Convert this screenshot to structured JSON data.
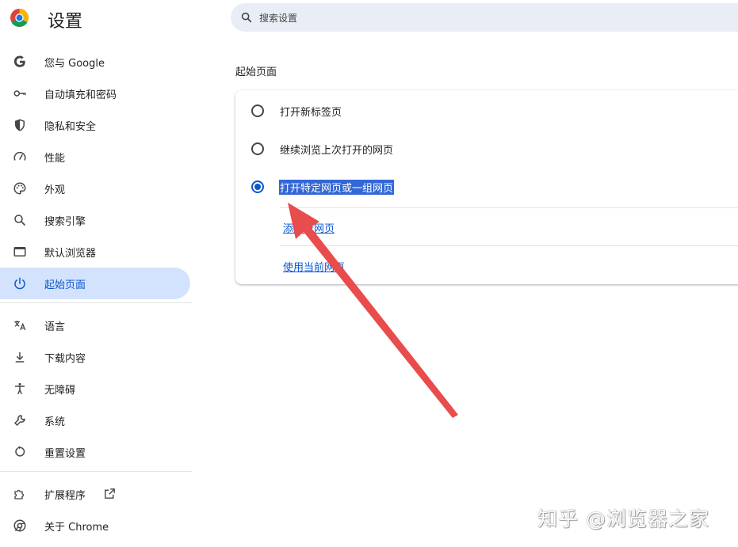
{
  "header": {
    "title": "设置",
    "search_placeholder": "搜索设置"
  },
  "sidebar": {
    "items": [
      {
        "label": "您与 Google",
        "icon": "google-g-icon"
      },
      {
        "label": "自动填充和密码",
        "icon": "key-icon"
      },
      {
        "label": "隐私和安全",
        "icon": "shield-icon"
      },
      {
        "label": "性能",
        "icon": "speedometer-icon"
      },
      {
        "label": "外观",
        "icon": "palette-icon"
      },
      {
        "label": "搜索引擎",
        "icon": "search-icon"
      },
      {
        "label": "默认浏览器",
        "icon": "browser-window-icon"
      },
      {
        "label": "起始页面",
        "icon": "power-icon",
        "active": true
      },
      {
        "label": "语言",
        "icon": "translate-icon"
      },
      {
        "label": "下载内容",
        "icon": "download-icon"
      },
      {
        "label": "无障碍",
        "icon": "accessibility-icon"
      },
      {
        "label": "系统",
        "icon": "wrench-icon"
      },
      {
        "label": "重置设置",
        "icon": "reset-icon"
      },
      {
        "label": "扩展程序",
        "icon": "puzzle-icon",
        "external": "external-link-icon"
      },
      {
        "label": "关于 Chrome",
        "icon": "chrome-icon"
      }
    ]
  },
  "main": {
    "section_title": "起始页面",
    "options": [
      {
        "label": "打开新标签页",
        "checked": false
      },
      {
        "label": "继续浏览上次打开的网页",
        "checked": false
      },
      {
        "label": "打开特定网页或一组网页",
        "checked": true
      }
    ],
    "links": {
      "add_page": "添加新网页",
      "use_current": "使用当前网页"
    }
  },
  "overlay": {
    "arrow_color": "#e84c4c",
    "watermark": "知乎 @浏览器之家"
  },
  "colors": {
    "accent": "#0b57d0",
    "active_bg": "#d3e3fd",
    "search_bg": "#e9eef6",
    "selection_bg": "#3367d6"
  }
}
